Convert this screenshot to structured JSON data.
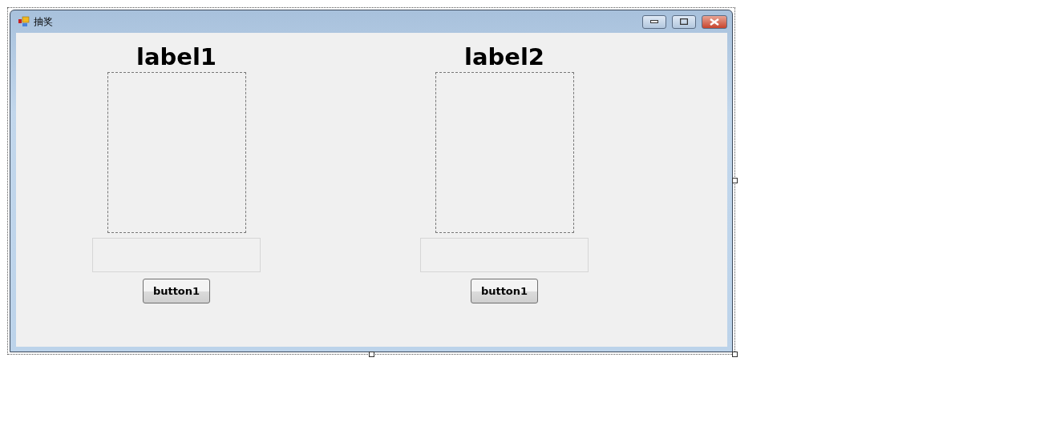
{
  "window": {
    "title": "抽奖"
  },
  "panels": [
    {
      "label": "label1",
      "button": "button1"
    },
    {
      "label": "label2",
      "button": "button1"
    }
  ]
}
